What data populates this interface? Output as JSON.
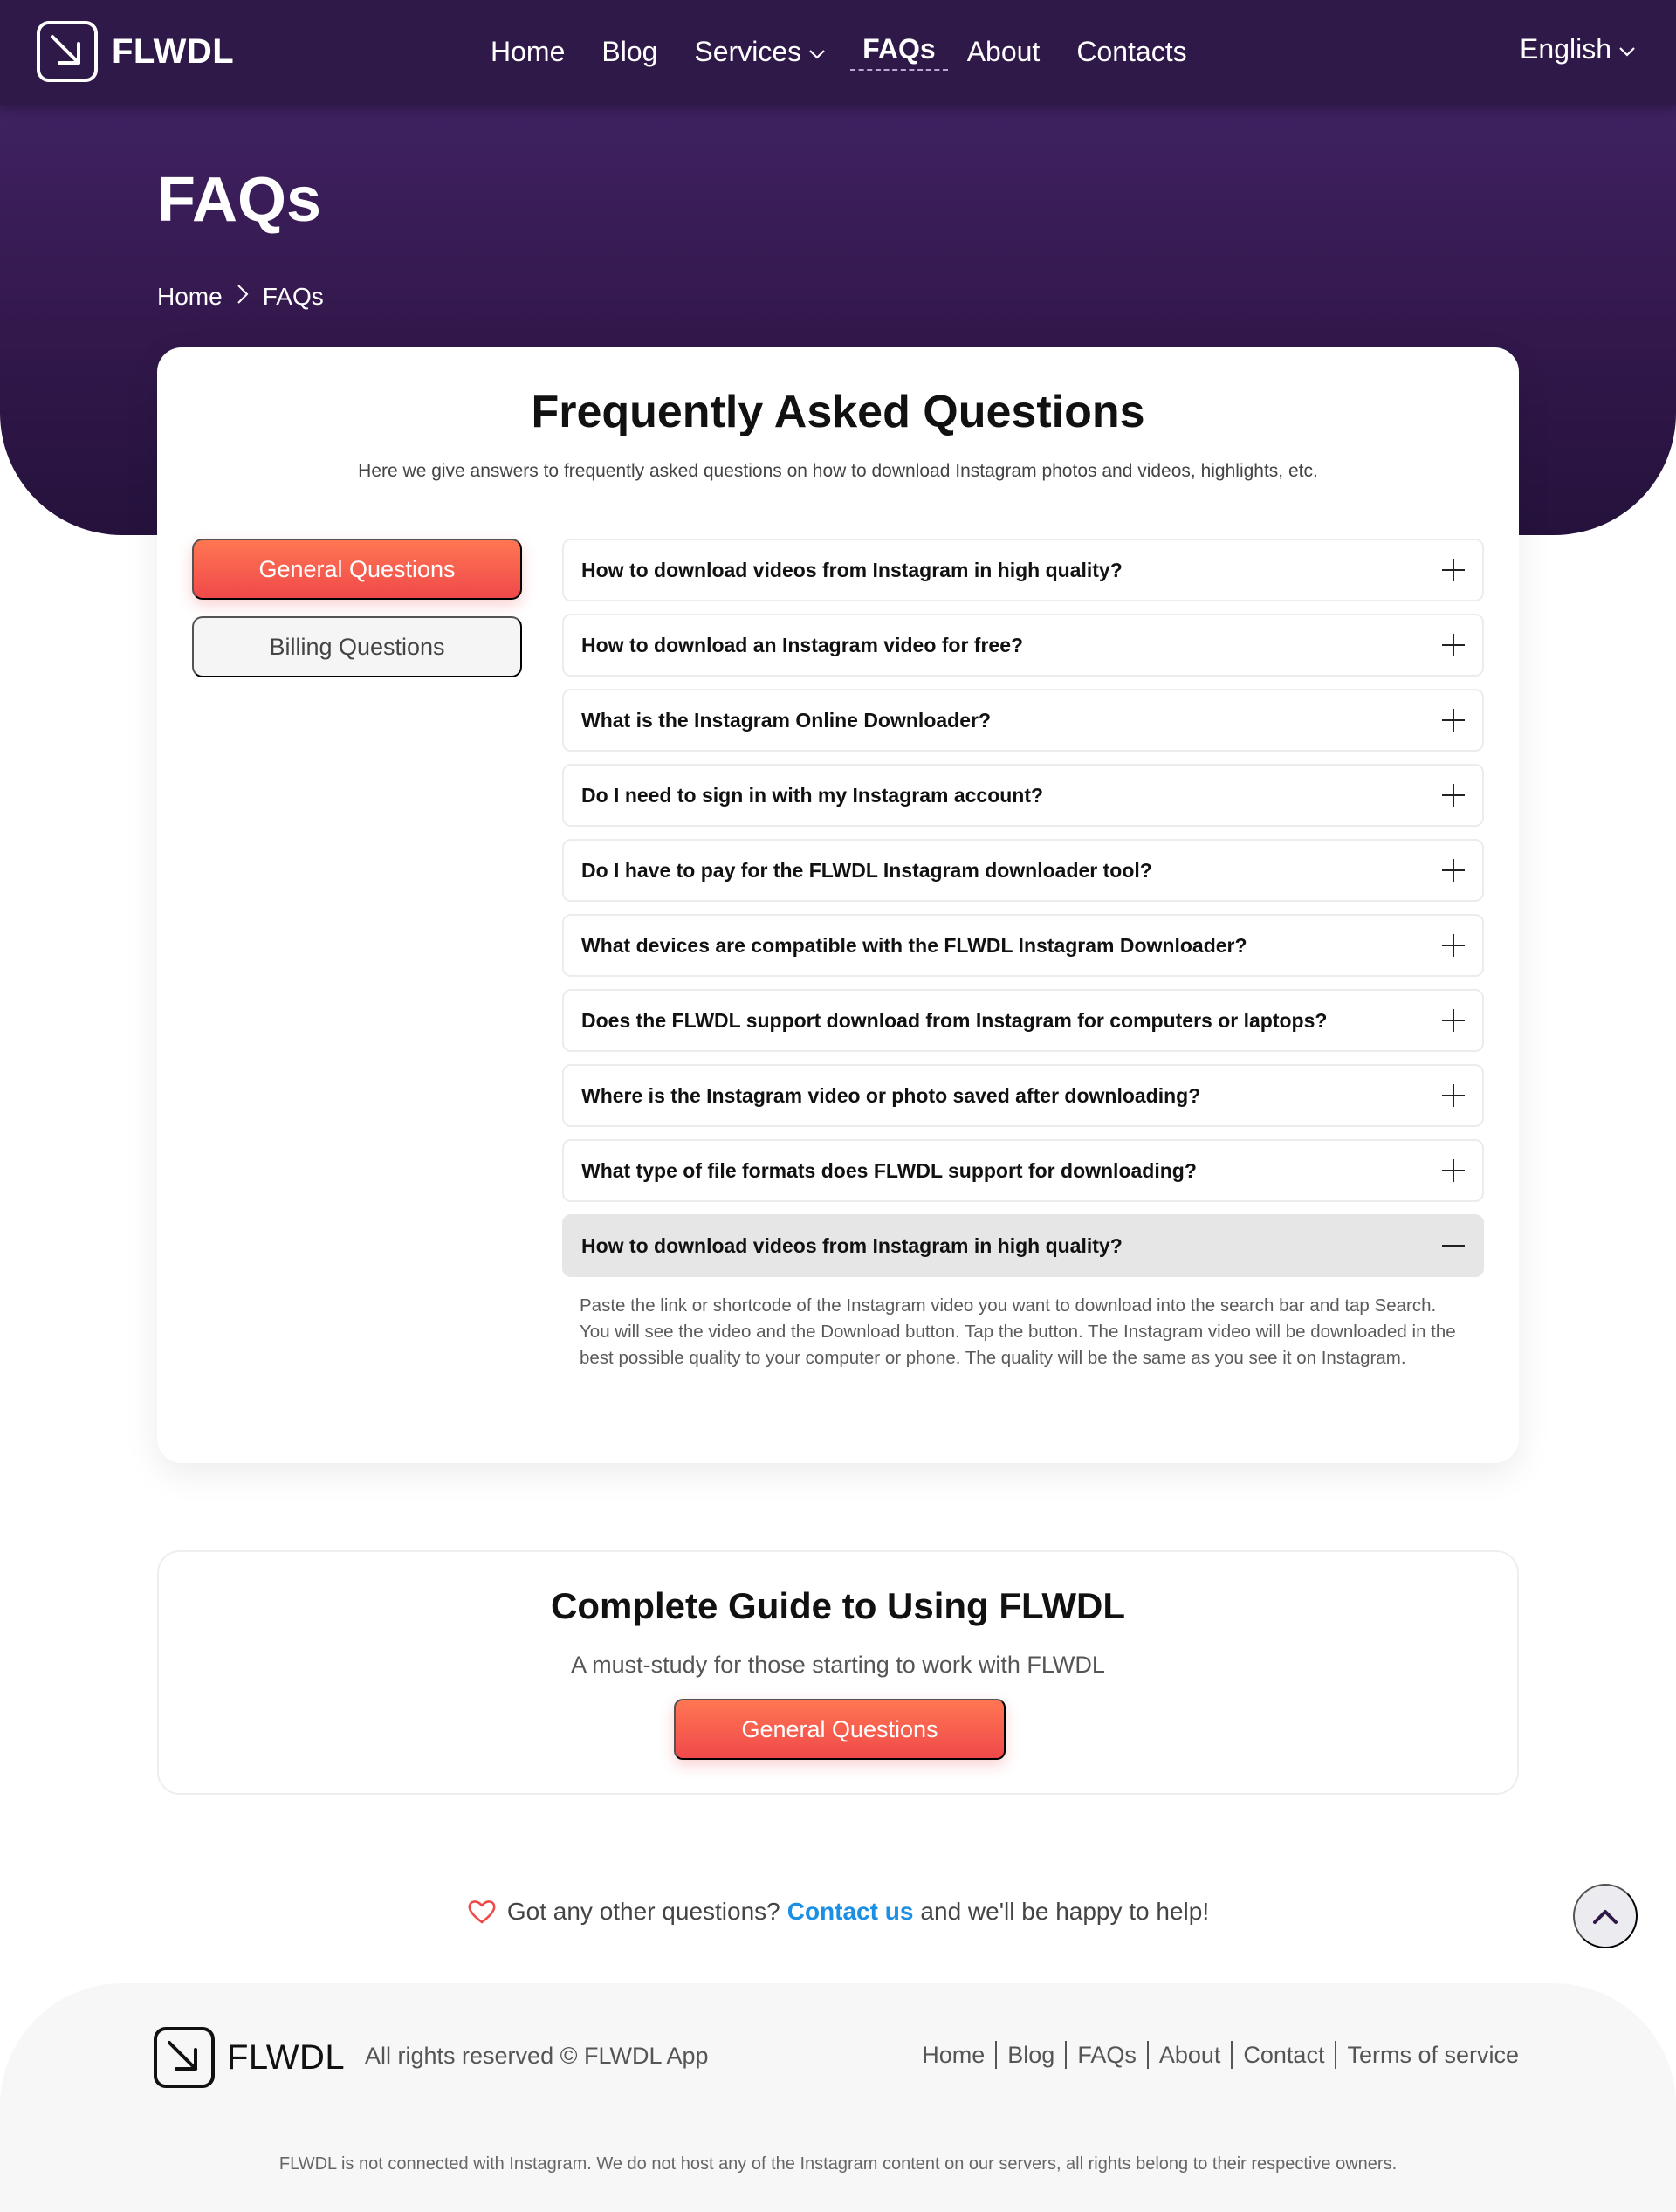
{
  "brand": {
    "name": "FLWDL"
  },
  "nav": {
    "items": [
      {
        "label": "Home"
      },
      {
        "label": "Blog"
      },
      {
        "label": "Services"
      },
      {
        "label": "FAQs"
      },
      {
        "label": "About"
      },
      {
        "label": "Contacts"
      }
    ],
    "language": "English"
  },
  "hero": {
    "title": "FAQs",
    "breadcrumb": {
      "home": "Home",
      "current": "FAQs"
    }
  },
  "faq": {
    "heading": "Frequently Asked Questions",
    "subheading": "Here we give answers to frequently asked questions on how to download Instagram photos and videos, highlights, etc.",
    "categories": [
      {
        "label": "General Questions",
        "active": true
      },
      {
        "label": "Billing Questions",
        "active": false
      }
    ],
    "questions": [
      {
        "q": "How to download videos from Instagram in high quality?",
        "open": false
      },
      {
        "q": "How to download an Instagram video for free?",
        "open": false
      },
      {
        "q": "What is the Instagram Online Downloader?",
        "open": false
      },
      {
        "q": "Do I need to sign in with my Instagram account?",
        "open": false
      },
      {
        "q": "Do I have to pay for the FLWDL Instagram downloader tool?",
        "open": false
      },
      {
        "q": "What devices are compatible with the FLWDL Instagram Downloader?",
        "open": false
      },
      {
        "q": "Does the FLWDL support download from Instagram for computers or laptops?",
        "open": false
      },
      {
        "q": "Where is the Instagram video or photo saved after downloading?",
        "open": false
      },
      {
        "q": "What type of file formats does FLWDL support for downloading?",
        "open": false
      },
      {
        "q": "How to download videos from Instagram in high quality?",
        "open": true
      }
    ],
    "open_answer": "Paste the link or shortcode of the Instagram video you want to download into the search bar and tap Search. You will see the video and the Download button. Tap the button. The Instagram video will be downloaded in the best possible quality to your computer or phone. The quality will be the same as you see it on Instagram."
  },
  "guide": {
    "title": "Complete Guide to Using FLWDL",
    "subtitle": "A must-study for those starting to work with FLWDL",
    "button": "General Questions"
  },
  "help": {
    "prefix": "Got any other questions?",
    "link": "Contact us",
    "suffix": "and we'll be happy to help!"
  },
  "footer": {
    "brand": "FLWDL",
    "rights": "All rights reserved © FLWDL App",
    "links": [
      "Home",
      "Blog",
      "FAQs",
      "About",
      "Contact",
      "Terms of service"
    ],
    "disclaimer": "FLWDL is not connected with Instagram. We do not host any of the Instagram content on our servers, all rights belong to their respective owners."
  },
  "colors": {
    "header_purple": "#2e1948",
    "accent_coral": "#f0494a",
    "link_blue": "#1a8fe3"
  }
}
